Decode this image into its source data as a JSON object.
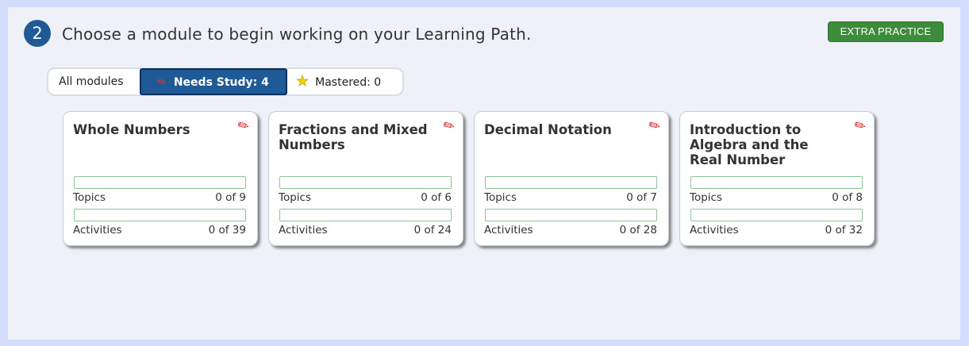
{
  "step": {
    "number": "2",
    "heading": "Choose a module to begin working on your Learning Path."
  },
  "extra_practice_label": "EXTRA PRACTICE",
  "filters": {
    "all": "All modules",
    "needs_study": "Needs Study: 4",
    "mastered": "Mastered: 0",
    "active": "needs_study"
  },
  "modules": [
    {
      "title": "Whole Numbers",
      "topics_label": "Topics",
      "topics_value": "0 of 9",
      "topics_progress": 0,
      "activities_label": "Activities",
      "activities_value": "0 of 39",
      "activities_progress": 0,
      "icon": "pencil-icon"
    },
    {
      "title": "Fractions and Mixed Numbers",
      "topics_label": "Topics",
      "topics_value": "0 of 6",
      "topics_progress": 0,
      "activities_label": "Activities",
      "activities_value": "0 of 24",
      "activities_progress": 0,
      "icon": "pencil-icon"
    },
    {
      "title": "Decimal Notation",
      "topics_label": "Topics",
      "topics_value": "0 of 7",
      "topics_progress": 0,
      "activities_label": "Activities",
      "activities_value": "0 of 28",
      "activities_progress": 0,
      "icon": "pencil-icon"
    },
    {
      "title": "Introduction to Algebra and the Real Number",
      "topics_label": "Topics",
      "topics_value": "0 of 8",
      "topics_progress": 0,
      "activities_label": "Activities",
      "activities_value": "0 of 32",
      "activities_progress": 0,
      "icon": "pencil-icon"
    }
  ],
  "colors": {
    "primary": "#1f5a97",
    "success": "#3d8b3d",
    "pencil": "#d02828",
    "star": "#f5d300",
    "progress_border": "#8cc49a"
  }
}
